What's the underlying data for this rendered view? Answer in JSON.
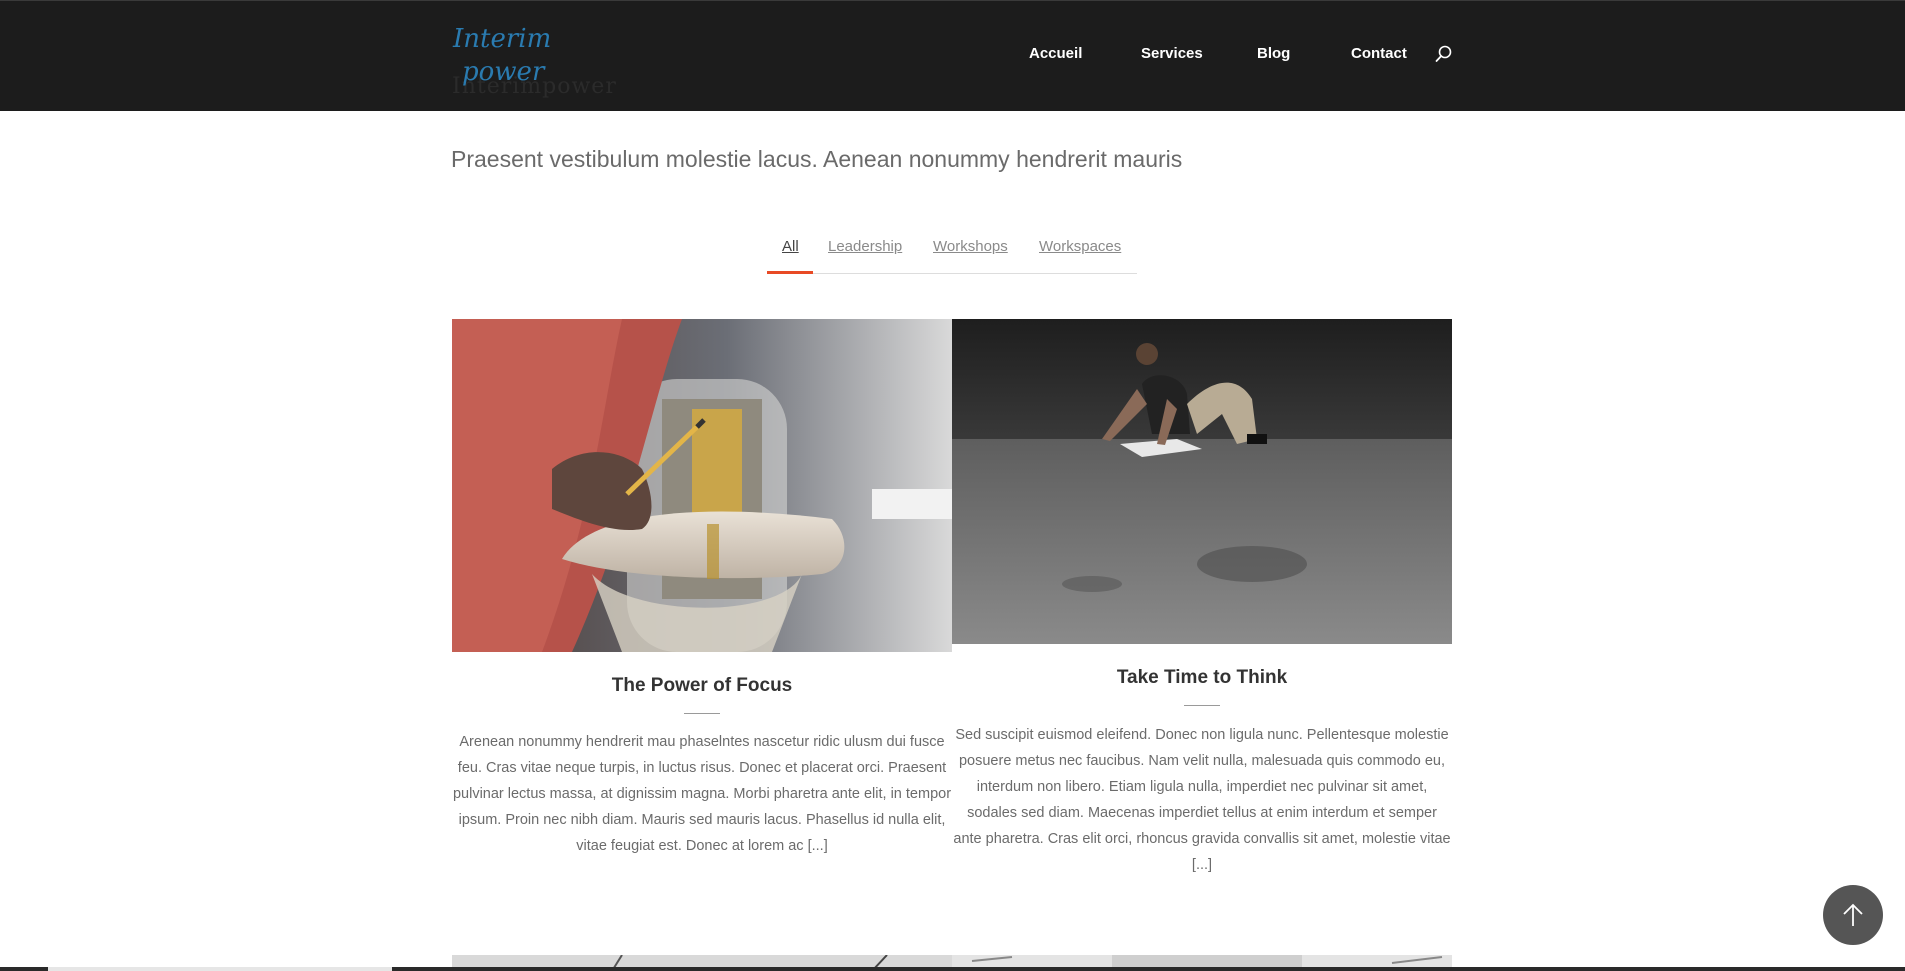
{
  "header": {
    "logo_line1": "Interim",
    "logo_line2": "power",
    "logo_ghost": "Interimpower",
    "nav": {
      "accueil": "Accueil",
      "services": "Services",
      "blog": "Blog",
      "contact": "Contact"
    },
    "search_icon": "search-icon"
  },
  "intro": {
    "subtitle": "Praesent vestibulum molestie lacus. Aenean nonummy hendrerit mauris"
  },
  "filters": [
    {
      "label": "All",
      "active": true
    },
    {
      "label": "Leadership",
      "active": false
    },
    {
      "label": "Workshops",
      "active": false
    },
    {
      "label": "Workspaces",
      "active": false
    }
  ],
  "posts": [
    {
      "title": "The Power of Focus",
      "excerpt": "Arenean nonummy hendrerit mau phaselntes nascetur ridic ulusm dui fusce feu. Cras vitae neque turpis, in luctus risus. Donec et placerat orci. Praesent pulvinar lectus massa, at dignissim magna. Morbi pharetra ante elit, in tempor ipsum. Proin nec nibh diam. Mauris sed mauris lacus. Phasellus id nulla elit, vitae feugiat est. Donec at lorem ac [...]"
    },
    {
      "title": "Take Time to Think",
      "excerpt": "Sed suscipit euismod eleifend. Donec non ligula nunc. Pellentesque molestie posuere metus nec faucibus. Nam velit nulla, malesuada quis commodo eu, interdum non libero. Etiam ligula nulla, imperdiet nec pulvinar sit amet, sodales sed diam. Maecenas imperdiet tellus at enim interdum et semper ante pharetra. Cras elit orci, rhoncus gravida convallis sit amet, molestie vitae [...]"
    }
  ],
  "colors": {
    "header_bg": "#1c1c1c",
    "logo": "#2a7bb0",
    "accent": "#e84a25",
    "back_to_top_bg": "#555555"
  },
  "back_to_top_icon": "arrow-up-icon"
}
